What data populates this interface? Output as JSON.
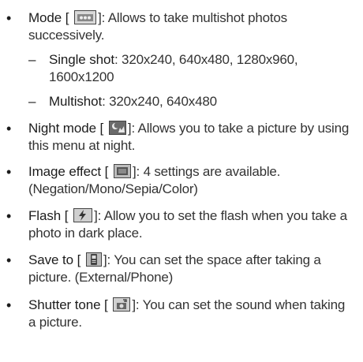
{
  "items": [
    {
      "term": "Mode [",
      "icon": "multishot-icon",
      "desc": "]: Allows to take multishot photos successively.",
      "subitems": [
        {
          "term": "Single shot",
          "desc": ": 320x240, 640x480, 1280x960, 1600x1200"
        },
        {
          "term": "Multishot",
          "desc": ": 320x240, 640x480"
        }
      ]
    },
    {
      "term": "Night mode [",
      "icon": "night-mode-icon",
      "desc": "]: Allows you to take a picture by using this menu at night."
    },
    {
      "term": "Image effect [",
      "icon": "image-effect-icon",
      "desc": "]: 4 settings are available. (Negation/Mono/Sepia/Color)"
    },
    {
      "term": "Flash [",
      "icon": "flash-icon",
      "desc": "]: Allow you to set the flash when you take a photo in dark place."
    },
    {
      "term": "Save to [",
      "icon": "save-to-phone-icon",
      "desc": "]: You can set the space after taking a picture. (External/Phone)"
    },
    {
      "term": "Shutter tone [",
      "icon": "shutter-tone-icon",
      "desc": "]: You can set the sound when taking a picture."
    }
  ]
}
